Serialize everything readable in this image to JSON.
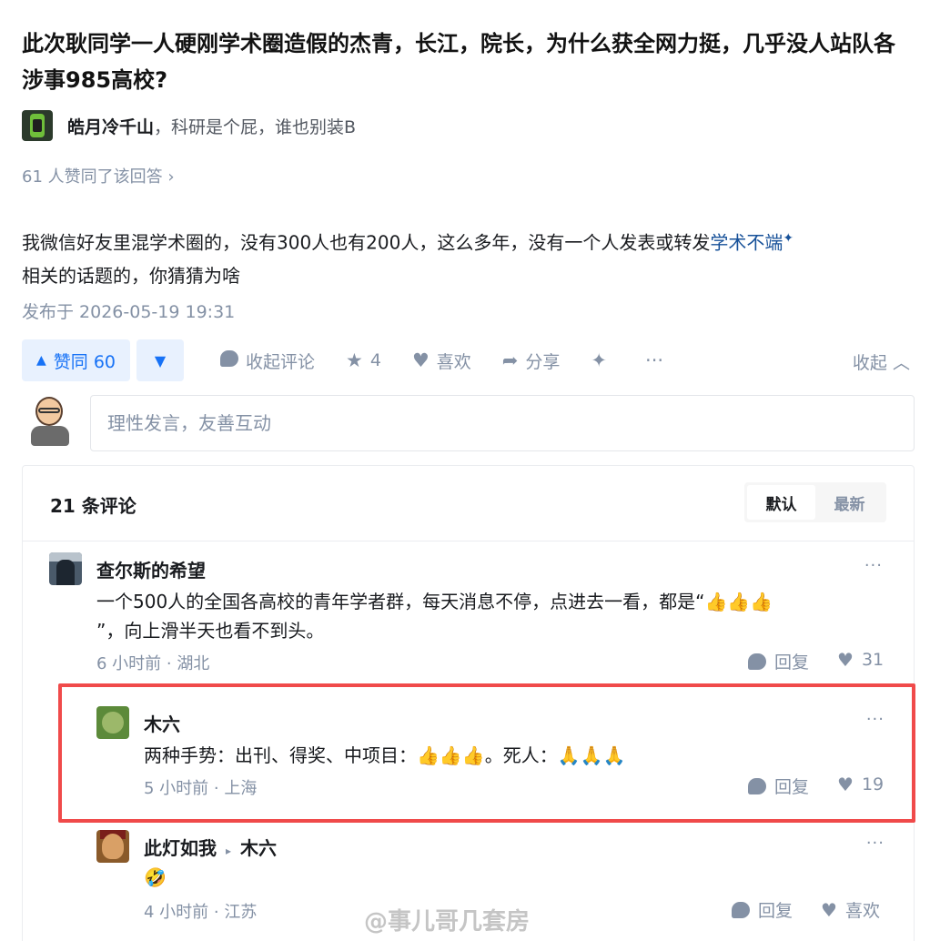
{
  "question": {
    "title": "此次耿同学一人硬刚学术圈造假的杰青，长江，院长，为什么获全网力挺，几乎没人站队各涉事985高校?"
  },
  "author": {
    "name": "皓月冷千山",
    "bio": "，科研是个屁，谁也别装B"
  },
  "vote_summary": "61 人赞同了该回答 ›",
  "answer": {
    "text_before": "我微信好友里混学术圈的，没有300人也有200人，这么多年，没有一个人发表或转发",
    "link": "学术不端",
    "text_after": "相关的话题的，你猜猜为啥",
    "publish_time": "发布于 2026-05-19 19:31"
  },
  "actions": {
    "upvote_label": "赞同 60",
    "comment_label": "收起评论",
    "favorite_count": "4",
    "like_label": "喜欢",
    "share_label": "分享",
    "collapse_label": "收起"
  },
  "comment_input": {
    "placeholder": "理性发言，友善互动"
  },
  "comments_section": {
    "header": "21 条评论",
    "sort_default": "默认",
    "sort_latest": "最新"
  },
  "comments": [
    {
      "author": "查尔斯的希望",
      "text_line1": "一个500人的全国各高校的青年学者群，每天消息不停，点进去一看，都是“👍👍👍",
      "text_line2": "”，向上滑半天也看不到头。",
      "time": "6 小时前",
      "location": "湖北",
      "reply_label": "回复",
      "likes": "31"
    },
    {
      "author": "木六",
      "text": "两种手势：出刊、得奖、中项目：👍👍👍。死人：🙏🙏🙏",
      "time": "5 小时前",
      "location": "上海",
      "reply_label": "回复",
      "likes": "19"
    },
    {
      "author": "此灯如我",
      "reply_to": "木六",
      "text": "🤣",
      "time": "4 小时前",
      "location": "江苏",
      "reply_label": "回复",
      "like_label": "喜欢"
    }
  ],
  "watermark": "@事儿哥几套房",
  "colors": {
    "accent": "#1772f6",
    "accent_bg": "#e8f1fe",
    "muted": "#8491a5",
    "highlight": "#f04a4a"
  }
}
